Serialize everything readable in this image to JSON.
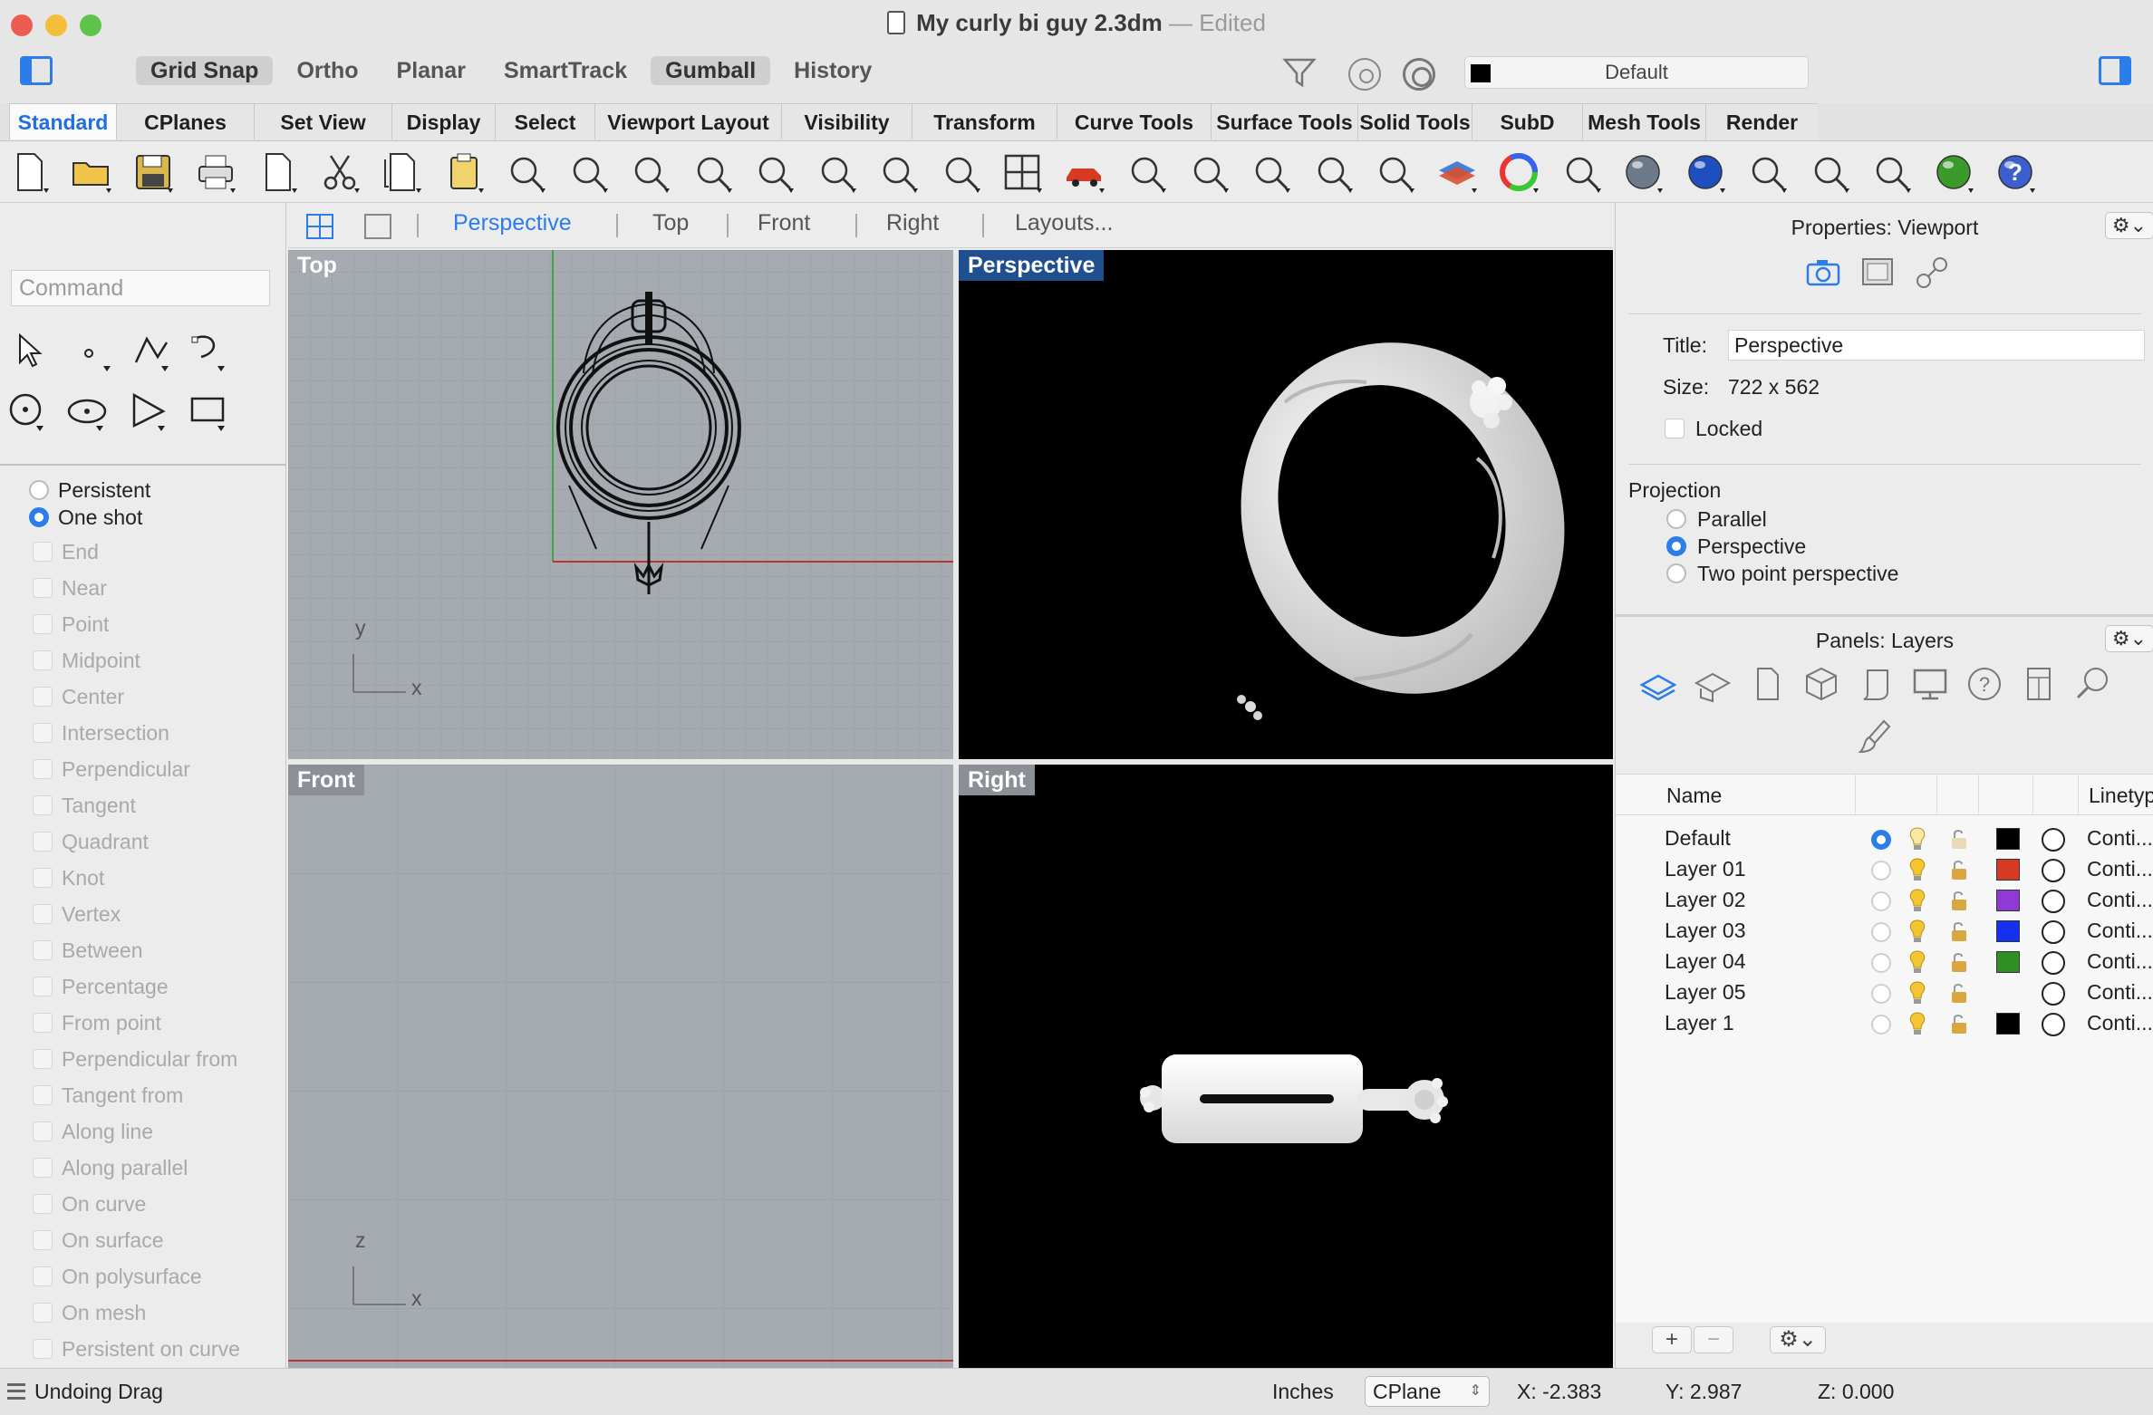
{
  "window": {
    "title": "My curly bi guy 2.3dm",
    "title_sep": "—",
    "status": "Edited"
  },
  "top_toolbar": {
    "modes": [
      {
        "label": "Grid Snap",
        "active": true
      },
      {
        "label": "Ortho",
        "active": false
      },
      {
        "label": "Planar",
        "active": false
      },
      {
        "label": "SmartTrack",
        "active": false
      },
      {
        "label": "Gumball",
        "active": true
      },
      {
        "label": "History",
        "active": false
      }
    ],
    "current_layer": "Default",
    "current_layer_color": "#000000"
  },
  "ribbon_tabs": [
    {
      "label": "Standard",
      "active": true
    },
    {
      "label": "CPlanes"
    },
    {
      "label": "Set View"
    },
    {
      "label": "Display"
    },
    {
      "label": "Select"
    },
    {
      "label": "Viewport Layout"
    },
    {
      "label": "Visibility"
    },
    {
      "label": "Transform"
    },
    {
      "label": "Curve Tools"
    },
    {
      "label": "Surface Tools"
    },
    {
      "label": "Solid Tools"
    },
    {
      "label": "SubD Tools"
    },
    {
      "label": "Mesh Tools"
    },
    {
      "label": "Render"
    }
  ],
  "toolbar_icons": [
    "new-file-icon",
    "open-folder-icon",
    "save-icon",
    "print-icon",
    "import-icon",
    "cut-icon",
    "copy-icon",
    "paste-icon",
    "undo-icon",
    "pan-hand-icon",
    "rotate-view-icon",
    "zoom-icon",
    "zoom-window-icon",
    "zoom-extents-icon",
    "zoom-selected-icon",
    "rotate-camera-icon",
    "four-viewports-icon",
    "car-render-icon",
    "grid-plane-icon",
    "point-icon",
    "snap-group-icon",
    "light-bulb-icon",
    "lock-icon",
    "layer-stack-icon",
    "color-wheel-icon",
    "sphere-wire-icon",
    "globe-icon",
    "material-ball-icon",
    "sun-icon",
    "dimension-icon",
    "nested-icon",
    "green-sphere-icon",
    "help-icon"
  ],
  "viewport_tabs": {
    "items": [
      {
        "label": "Perspective",
        "active": true
      },
      {
        "label": "Top"
      },
      {
        "label": "Front"
      },
      {
        "label": "Right"
      },
      {
        "label": "Layouts..."
      }
    ]
  },
  "command": {
    "placeholder": "Command"
  },
  "osnap": {
    "modes": [
      {
        "label": "Persistent",
        "selected": false
      },
      {
        "label": "One shot",
        "selected": true
      }
    ],
    "items": [
      "End",
      "Near",
      "Point",
      "Midpoint",
      "Center",
      "Intersection",
      "Perpendicular",
      "Tangent",
      "Quadrant",
      "Knot",
      "Vertex",
      "Between",
      "Percentage",
      "From point",
      "Perpendicular from",
      "Tangent from",
      "Along line",
      "Along parallel",
      "On curve",
      "On surface",
      "On polysurface",
      "On mesh",
      "Persistent on curve"
    ]
  },
  "viewports": {
    "top": {
      "label": "Top",
      "axis_x": "x",
      "axis_y": "y"
    },
    "perspective": {
      "label": "Perspective"
    },
    "front": {
      "label": "Front",
      "axis_x": "x",
      "axis_y": "z"
    },
    "right": {
      "label": "Right"
    }
  },
  "properties": {
    "header": "Properties: Viewport",
    "gear_label": "⚙︎⌄",
    "title_label": "Title:",
    "title_value": "Perspective",
    "size_label": "Size:",
    "size_value": "722 x 562",
    "locked_label": "Locked",
    "projection_label": "Projection",
    "projection_options": [
      {
        "label": "Parallel",
        "selected": false
      },
      {
        "label": "Perspective",
        "selected": true
      },
      {
        "label": "Two point perspective",
        "selected": false
      }
    ]
  },
  "layers_panel": {
    "header": "Panels: Layers",
    "gear_label": "⚙︎⌄",
    "columns": {
      "name": "Name",
      "linetype": "Linetyp"
    },
    "rows": [
      {
        "name": "Default",
        "current": true,
        "color": "#000000",
        "linetype": "Conti..."
      },
      {
        "name": "Layer 01",
        "current": false,
        "color": "#d63a22",
        "linetype": "Conti..."
      },
      {
        "name": "Layer 02",
        "current": false,
        "color": "#8f3ad6",
        "linetype": "Conti..."
      },
      {
        "name": "Layer 03",
        "current": false,
        "color": "#1630f0",
        "linetype": "Conti..."
      },
      {
        "name": "Layer 04",
        "current": false,
        "color": "#2e8f23",
        "linetype": "Conti..."
      },
      {
        "name": "Layer 05",
        "current": false,
        "color": "",
        "linetype": "Conti..."
      },
      {
        "name": "Layer 1",
        "current": false,
        "color": "#000000",
        "linetype": "Conti..."
      }
    ],
    "add_label": "+",
    "remove_label": "−",
    "options_label": "⚙︎⌄"
  },
  "status_bar": {
    "message": "Undoing Drag",
    "units": "Inches",
    "cplane": "CPlane",
    "x": "X: -2.383",
    "y": "Y: 2.987",
    "z": "Z: 0.000"
  }
}
